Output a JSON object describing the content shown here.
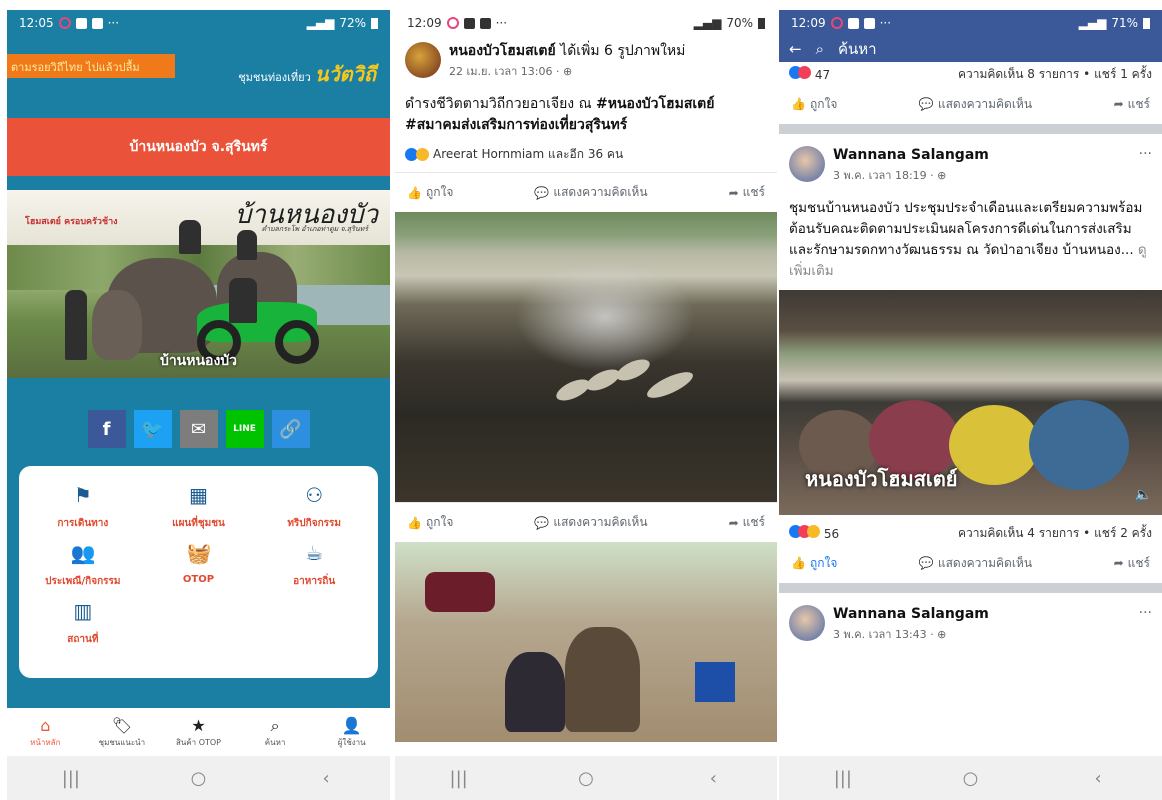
{
  "panel1": {
    "status": {
      "time": "12:05",
      "battery": "72%"
    },
    "top_banner": "ตามรอยวิถีไทย ไปแล้วปลื้ม",
    "community_label": "ชุมชนท่องเที่ยว",
    "brand_label": "นวัตวิถี",
    "red_bar_title": "บ้านหนองบัว จ.สุรินทร์",
    "hero": {
      "caption": "บ้านหนองบัว",
      "logo": "บ้านหนองบัว",
      "logo_sub": "ตำบลกระโพ อำเภอท่าตูม จ.สุรินทร์",
      "homestay": "โฮมสเตย์ ครอบครัวช้าง"
    },
    "share_buttons": [
      {
        "name": "facebook",
        "glyph": "f",
        "color": "#3b5998"
      },
      {
        "name": "twitter",
        "glyph": "🐦",
        "color": "#1da1f2"
      },
      {
        "name": "email",
        "glyph": "✉",
        "color": "#7d7d7d"
      },
      {
        "name": "line",
        "glyph": "LINE",
        "color": "#00c300"
      },
      {
        "name": "link",
        "glyph": "🔗",
        "color": "#2c8fe0"
      }
    ],
    "menu": [
      {
        "icon": "flag-icon",
        "glyph": "⚑",
        "label": "การเดินทาง"
      },
      {
        "icon": "map-icon",
        "glyph": "▦",
        "label": "แผนที่ชุมชน"
      },
      {
        "icon": "activity-icon",
        "glyph": "⚇",
        "label": "ทริปกิจกรรม"
      },
      {
        "icon": "people-icon",
        "glyph": "👥",
        "label": "ประเพณี/กิจกรรม"
      },
      {
        "icon": "basket-icon",
        "glyph": "🧺",
        "label": "OTOP"
      },
      {
        "icon": "cup-icon",
        "glyph": "☕",
        "label": "อาหารถิ่น"
      },
      {
        "icon": "building-icon",
        "glyph": "▥",
        "label": "สถานที่"
      }
    ],
    "bottom_nav": [
      {
        "icon": "home-icon",
        "glyph": "⌂",
        "label": "หน้าหลัก",
        "active": true
      },
      {
        "icon": "tags-icon",
        "glyph": "🏷",
        "label": "ชุมชนแนะนำ",
        "active": false
      },
      {
        "icon": "star-icon",
        "glyph": "★",
        "label": "สินค้า OTOP",
        "active": false
      },
      {
        "icon": "search-icon",
        "glyph": "⌕",
        "label": "ค้นหา",
        "active": false
      },
      {
        "icon": "user-icon",
        "glyph": "👤",
        "label": "ผู้ใช้งาน",
        "active": false
      }
    ]
  },
  "panel2": {
    "status": {
      "time": "12:09",
      "battery": "70%"
    },
    "post": {
      "author": "หนองบัวโฮมสเตย์",
      "action": " ได้เพิ่ม 6 รูปภาพใหม่",
      "time": "22 เม.ย. เวลา 13:06 · ",
      "text_plain": "ดำรงชีวิตตามวิถีกวยอาเจียง ณ ",
      "hashtag1": "#หนองบัวโฮมสเตย์",
      "hashtag2": " #สมาคมส่งเสริมการท่องเที่ยวสุรินทร์",
      "reactions": "Areerat Hornmiam และอีก 36 คน"
    },
    "actions": {
      "like": "ถูกใจ",
      "comment": "แสดงความคิดเห็น",
      "share": "แชร์"
    }
  },
  "panel3": {
    "status": {
      "time": "12:09",
      "battery": "71%"
    },
    "search_placeholder": "ค้นหา",
    "prev_stats": {
      "count": "47",
      "summary": "ความคิดเห็น 8 รายการ • แชร์ 1 ครั้ง"
    },
    "post": {
      "author": "Wannana Salangam",
      "time": "3 พ.ค. เวลา 18:19 · ",
      "text": "ชุมชนบ้านหนองบัว ประชุมประจำเดือนและเตรียมความพร้อมต้อนรับคณะติดตามประเมินผลโครงการดีเด่นในการส่งเสริมและรักษามรดกทางวัฒนธรรม ณ วัดป่าอาเจียง บ้านหนอง...",
      "more": " ดูเพิ่มเติม",
      "photo_caption": "หนองบัวโฮมสเตย์",
      "stats": {
        "count": "56",
        "summary": "ความคิดเห็น 4 รายการ • แชร์ 2 ครั้ง"
      }
    },
    "next_post": {
      "author": "Wannana Salangam",
      "time": "3 พ.ค. เวลา 13:43 · "
    },
    "actions": {
      "like": "ถูกใจ",
      "comment": "แสดงความคิดเห็น",
      "share": "แชร์"
    }
  },
  "system_nav": {
    "recent": "|||",
    "home": "○",
    "back": "‹"
  }
}
